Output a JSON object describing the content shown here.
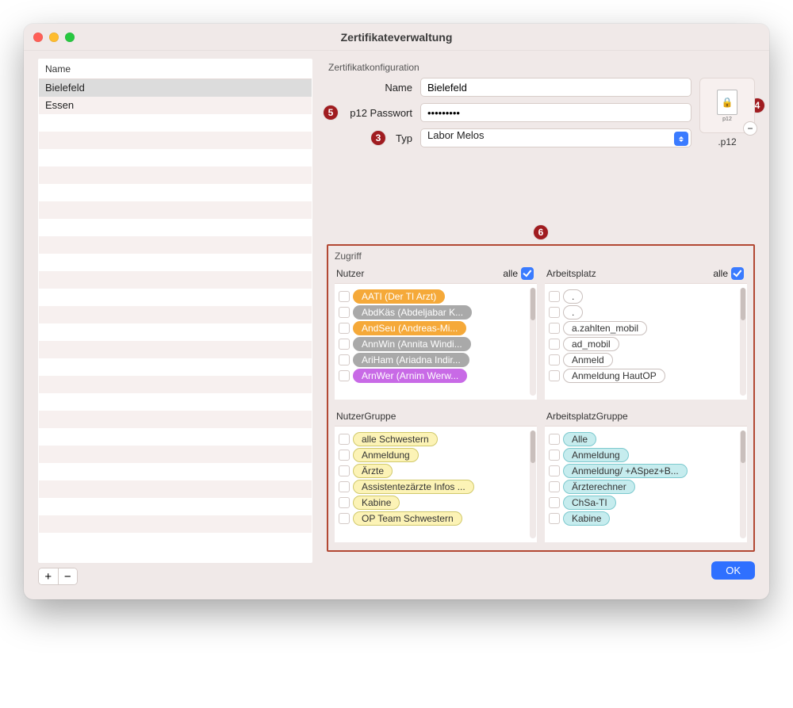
{
  "window_title": "Zertifikateverwaltung",
  "left": {
    "header": "Name",
    "items": [
      "Bielefeld",
      "Essen"
    ],
    "selected_index": 0,
    "add_label": "+",
    "remove_label": "−"
  },
  "config": {
    "section_title": "Zertifikatkonfiguration",
    "name_label": "Name",
    "name_value": "Bielefeld",
    "pass_label": "p12 Passwort",
    "pass_value": "•••••••••",
    "type_label": "Typ",
    "type_value": "Labor Melos",
    "p12_icon_caption": "p12",
    "p12_ext": ".p12"
  },
  "hints": {
    "h3": "3",
    "h4": "4",
    "h5": "5",
    "h6": "6"
  },
  "access": {
    "section_title": "Zugriff",
    "all_label": "alle",
    "panels": {
      "nutzer": {
        "title": "Nutzer",
        "all_checked": true,
        "items": [
          {
            "label": "AATI (Der TI Arzt)",
            "tone": "orange"
          },
          {
            "label": "AbdKäs (Abdeljabar K...",
            "tone": "gray"
          },
          {
            "label": "AndSeu (Andreas-Mi...",
            "tone": "orange"
          },
          {
            "label": "AnnWin (Annita Windi...",
            "tone": "gray"
          },
          {
            "label": "AriHam (Ariadna Indir...",
            "tone": "gray"
          },
          {
            "label": "ArnWer (Arnim Werw...",
            "tone": "purple"
          }
        ]
      },
      "arbeitsplatz": {
        "title": "Arbeitsplatz",
        "all_checked": true,
        "items": [
          {
            "label": ".",
            "tone": "white"
          },
          {
            "label": ".",
            "tone": "white"
          },
          {
            "label": "a.zahlten_mobil",
            "tone": "white"
          },
          {
            "label": "ad_mobil",
            "tone": "white"
          },
          {
            "label": "Anmeld",
            "tone": "white"
          },
          {
            "label": "Anmeldung HautOP",
            "tone": "white"
          }
        ]
      },
      "nutzergruppe": {
        "title": "NutzerGruppe",
        "items": [
          {
            "label": "alle Schwestern",
            "tone": "yellow"
          },
          {
            "label": "Anmeldung",
            "tone": "yellow"
          },
          {
            "label": "Ärzte",
            "tone": "yellow"
          },
          {
            "label": "Assistentezärzte Infos ...",
            "tone": "yellow"
          },
          {
            "label": "Kabine",
            "tone": "yellow"
          },
          {
            "label": "OP Team Schwestern",
            "tone": "yellow"
          }
        ]
      },
      "arbeitsplatzgruppe": {
        "title": "ArbeitsplatzGruppe",
        "items": [
          {
            "label": "Alle",
            "tone": "cyan"
          },
          {
            "label": "Anmeldung",
            "tone": "cyan"
          },
          {
            "label": "Anmeldung/ +ASpez+B...",
            "tone": "cyan"
          },
          {
            "label": "Ärzterechner",
            "tone": "cyan"
          },
          {
            "label": "ChSa-TI",
            "tone": "cyan"
          },
          {
            "label": "Kabine",
            "tone": "cyan"
          }
        ]
      }
    }
  },
  "ok_label": "OK"
}
